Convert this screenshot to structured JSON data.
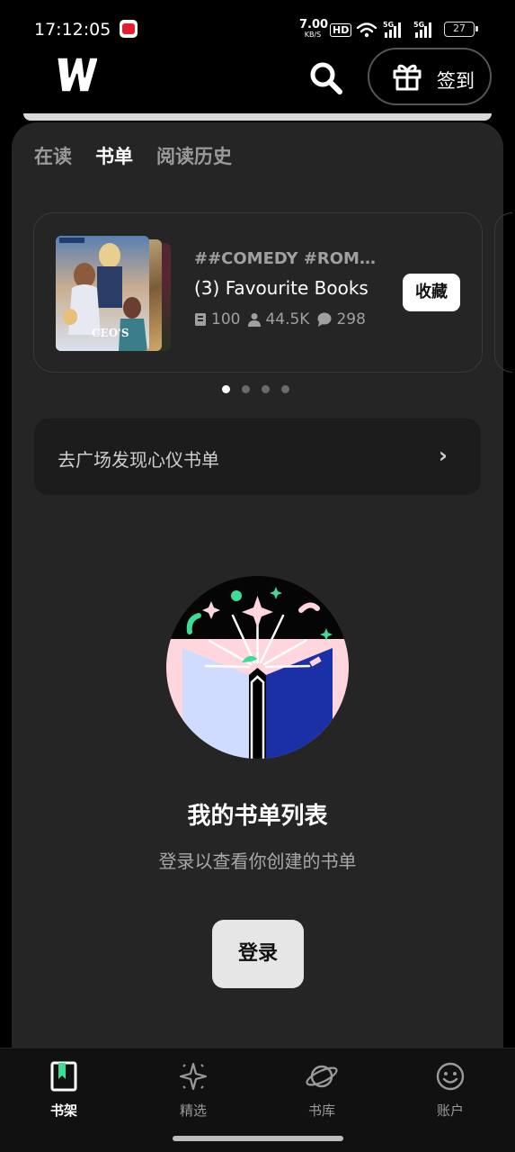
{
  "status_bar": {
    "time": "17:12:05",
    "net_speed": "7.00",
    "net_speed_unit": "KB/S",
    "hd_label": "HD",
    "signal_labels": [
      "5G",
      "5G"
    ],
    "battery": "27"
  },
  "header": {
    "logo_icon": "w-logo-icon",
    "search_icon": "search-icon",
    "checkin_icon": "gift-icon",
    "checkin_label": "签到"
  },
  "tabs": [
    {
      "label": "在读",
      "active": false
    },
    {
      "label": "书单",
      "active": true
    },
    {
      "label": "阅读历史",
      "active": false
    }
  ],
  "booklist_card": {
    "tags": "##COMEDY #ROMA...",
    "title": "(3) Favourite Books",
    "books": "100",
    "followers": "44.5K",
    "comments": "298",
    "save_label": "收藏"
  },
  "carousel": {
    "count": 4,
    "active_index": 0
  },
  "discover": {
    "label": "去广场发现心仪书单",
    "arrow": "›"
  },
  "empty_state": {
    "title": "我的书单列表",
    "subtitle": "登录以查看你创建的书单",
    "login_label": "登录"
  },
  "bottom_nav": [
    {
      "label": "书架",
      "icon": "bookshelf-icon",
      "active": true
    },
    {
      "label": "精选",
      "icon": "sparkle-icon",
      "active": false
    },
    {
      "label": "书库",
      "icon": "planet-icon",
      "active": false
    },
    {
      "label": "账户",
      "icon": "smile-icon",
      "active": false
    }
  ],
  "colors": {
    "background": "#000000",
    "panel": "#252525",
    "accent_green": "#3ddc97",
    "accent_pink": "#ffd3dc",
    "book_blue": "#1b2fa6"
  }
}
